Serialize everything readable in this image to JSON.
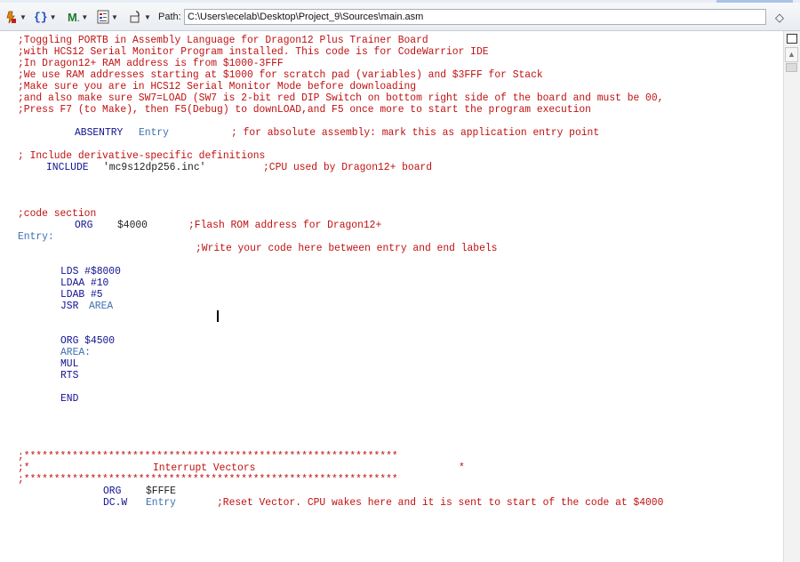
{
  "toolbar": {
    "path_label": "Path:",
    "path_value": "C:\\Users\\ecelab\\Desktop\\Project_9\\Sources\\main.asm",
    "icons": [
      "debug-tool-icon",
      "braces-icon",
      "bookmark-m-icon",
      "document-properties-icon",
      "lock-icon",
      "diamond-icon"
    ]
  },
  "colors": {
    "comment": "#c01010",
    "keyword": "#101090",
    "label": "#3f6fb0"
  },
  "code": {
    "l1": ";Toggling PORTB in Assembly Language for Dragon12 Plus Trainer Board",
    "l2": ";with HCS12 Serial Monitor Program installed. This code is for CodeWarrior IDE",
    "l3": ";In Dragon12+ RAM address is from $1000-3FFF",
    "l4": ";We use RAM addresses starting at $1000 for scratch pad (variables) and $3FFF for Stack",
    "l5": ";Make sure you are in HCS12 Serial Monitor Mode before downloading",
    "l6": ";and also make sure SW7=LOAD (SW7 is 2-bit red DIP Switch on bottom right side of the board and must be 00,",
    "l7": ";Press F7 (to Make), then F5(Debug) to downLOAD,and F5 once more to start the program execution",
    "absentry_kw": "ABSENTRY",
    "absentry_arg": "Entry",
    "absentry_cm": "; for absolute assembly: mark this as application entry point",
    "include_cm": "; Include derivative-specific definitions",
    "include_kw": "INCLUDE",
    "include_arg": "'mc9s12dp256.inc'",
    "include_tail": ";CPU used by Dragon12+ board",
    "code_section": ";code section",
    "org_kw": "ORG",
    "org_arg": "$4000",
    "org_cm": ";Flash ROM address for Dragon12+",
    "entry_label": "Entry:",
    "write_cm": ";Write your code here between entry and end labels",
    "lds": "LDS #$8000",
    "ldaa": "LDAA #10",
    "ldab": "LDAB #5",
    "jsr_kw": "JSR",
    "jsr_arg": "AREA",
    "org2": "ORG $4500",
    "area_label": "AREA:",
    "mul": "MUL",
    "rts": "RTS",
    "end": "END",
    "stars": ";**************************************************************",
    "iv_left": ";*",
    "iv_title": "Interrupt Vectors",
    "iv_right": "*",
    "org3_kw": "ORG",
    "org3_arg": "$FFFE",
    "dcw_kw": "DC.W",
    "dcw_arg": "Entry",
    "dcw_cm": ";Reset Vector. CPU wakes here and it is sent to start of the code at $4000"
  }
}
